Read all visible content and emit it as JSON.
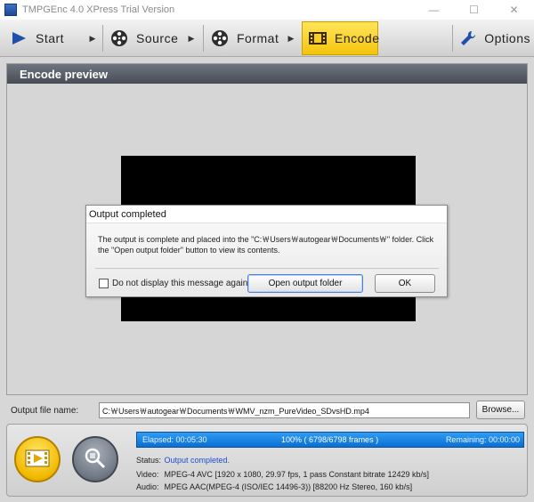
{
  "window": {
    "title": "TMPGEnc 4.0 XPress Trial Version",
    "controls": [
      "—",
      "☐",
      "✕"
    ]
  },
  "toolbar": {
    "start_label": "Start",
    "source_label": "Source",
    "format_label": "Format",
    "encode_label": "Encode",
    "options_label": "Options",
    "arrow": "▶",
    "active_tab": "Encode",
    "active_color": "#f6cf1f"
  },
  "preview": {
    "header": "Encode preview"
  },
  "dialog": {
    "title": "Output completed",
    "message": "The output is complete and placed into the \"C:￦Users￦autogear￦Documents￦\" folder. Click the \"Open output folder\" button to view its contents.",
    "checkbox_label": "Do not display this message again",
    "checkbox_checked": false,
    "open_folder_button": "Open output folder",
    "ok_button": "OK"
  },
  "output": {
    "label": "Output file name:",
    "value": "C:￦Users￦autogear￦Documents￦WMV_nzm_PureVideo_SDvsHD.mp4",
    "browse_button": "Browse..."
  },
  "progress": {
    "elapsed": "Elapsed: 00:05:30",
    "percent_text": "100% ( 6798/6798  frames )",
    "remaining": "Remaining: 00:00:00",
    "fraction": 1.0,
    "color": "#1a86e6"
  },
  "info": {
    "status_key": "Status:",
    "status_value": "Output completed.",
    "video_key": "Video:",
    "video_value": "MPEG-4 AVC [1920 x 1080, 29.97 fps, 1 pass Constant bitrate 12429 kb/s]",
    "audio_key": "Audio:",
    "audio_value": "MPEG AAC(MPEG-4 (ISO/IEC 14496-3)) [88200 Hz Stereo, 160 kb/s]"
  }
}
